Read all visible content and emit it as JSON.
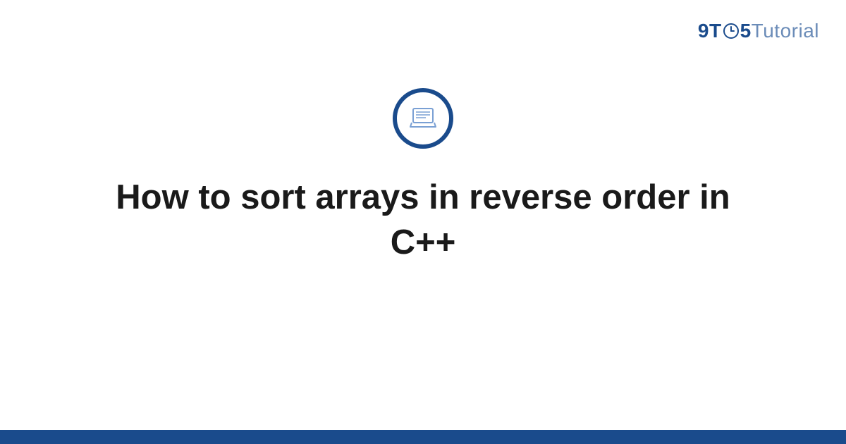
{
  "logo": {
    "part1": "9T",
    "part2": "5",
    "part3": "Tutorial"
  },
  "title": "How to sort arrays in reverse order in C++",
  "colors": {
    "primary": "#1a4b8c",
    "secondary": "#6b8cb8",
    "iconStroke": "#7aa0d4"
  }
}
